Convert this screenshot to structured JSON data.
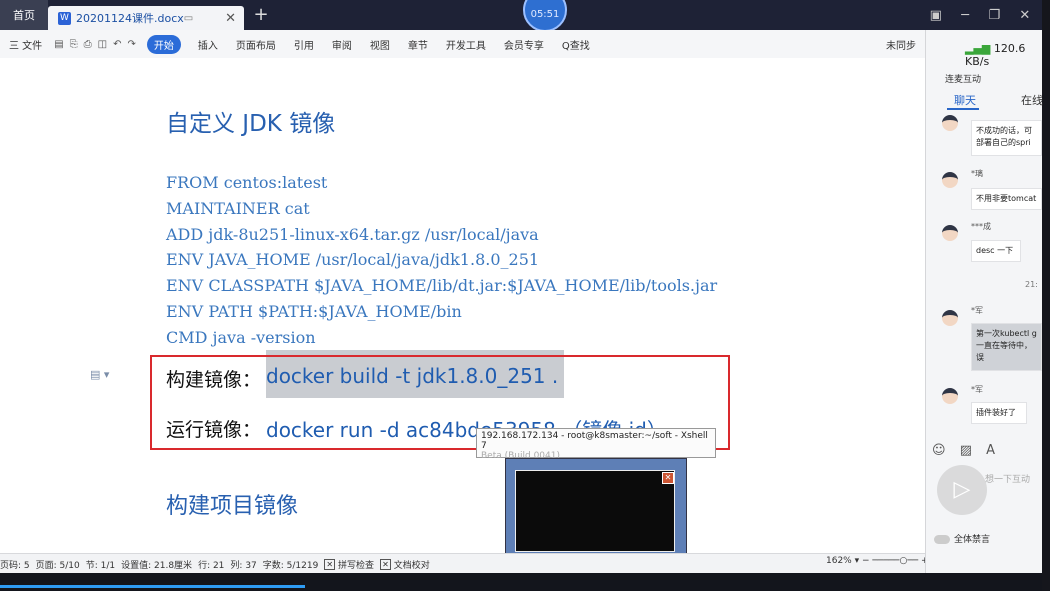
{
  "titlebar": {
    "home_tab": "首页",
    "doc_tab": "20201124课件.docx",
    "timer": "05:51"
  },
  "toolbar": {
    "file_menu": "三 文件",
    "start": "开始",
    "items": [
      "插入",
      "页面布局",
      "引用",
      "审阅",
      "视图",
      "章节",
      "开发工具",
      "会员专享",
      "Q查找"
    ],
    "sync": "未同步"
  },
  "document": {
    "heading1": "自定义 JDK 镜像",
    "code_lines": [
      "FROM centos:latest",
      "MAINTAINER cat",
      "ADD jdk-8u251-linux-x64.tar.gz /usr/local/java",
      "ENV JAVA_HOME /usr/local/java/jdk1.8.0_251",
      "ENV CLASSPATH $JAVA_HOME/lib/dt.jar:$JAVA_HOME/lib/tools.jar",
      "ENV PATH $PATH:$JAVA_HOME/bin",
      "CMD java -version"
    ],
    "build_label": "构建镜像：",
    "build_cmd": "docker build -t jdk1.8.0_251 .",
    "run_label": "运行镜像：",
    "run_cmd": "docker run -d ac84bde53958 （镜像 id）",
    "heading2": "构建项目镜像"
  },
  "tooltip": {
    "title": "192.168.172.134 - root@k8smaster:~/soft - Xshell 7",
    "sub": "Beta (Build 0041)"
  },
  "statusbar": {
    "page_code": "页码: 5",
    "page": "页面: 5/10",
    "section": "节: 1/1",
    "setting": "设置值: 21.8厘米",
    "row": "行: 21",
    "col": "列: 37",
    "words": "字数: 5/1219",
    "spell": "拼写检查",
    "proof": "文档校对",
    "zoom": "162%"
  },
  "panel": {
    "net_speed": "120.6 KB/s",
    "lianmai": "连麦互动",
    "tab_chat": "聊天",
    "tab_online": "在线",
    "messages": [
      {
        "name": "",
        "text": "不成功的话，可部署自己的spri"
      },
      {
        "name": "*璃",
        "text": "不用非要tomcat"
      },
      {
        "name": "***成",
        "text": "desc 一下"
      },
      {
        "name": "*军",
        "text": "第一次kubectl g一直在等待中，误"
      },
      {
        "name": "*军",
        "text": "插件装好了"
      }
    ],
    "time": "21:",
    "input_hint": "想一下互动",
    "mute": "全体禁言"
  }
}
